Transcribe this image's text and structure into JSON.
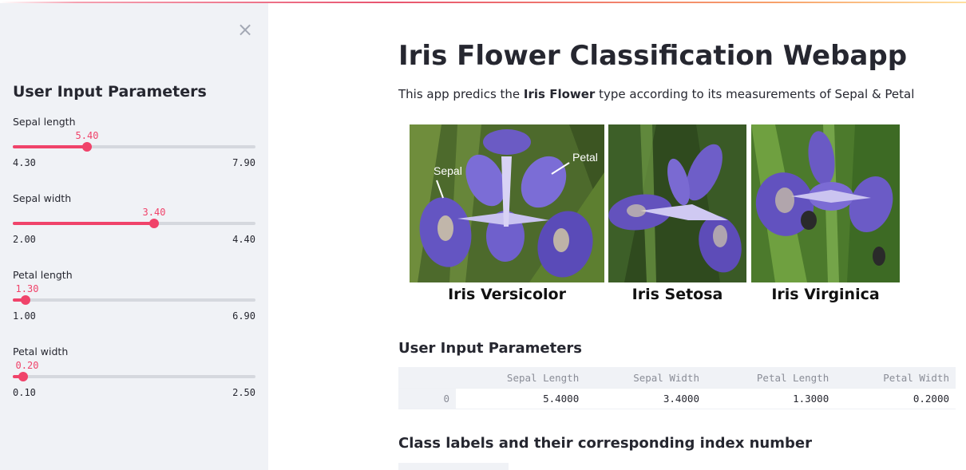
{
  "sidebar": {
    "close_icon": "×",
    "title": "User Input Parameters",
    "accent": "#f0436a",
    "sliders": [
      {
        "label": "Sepal length",
        "value": "5.40",
        "min": "4.30",
        "max": "7.90",
        "fraction": 0.306
      },
      {
        "label": "Sepal width",
        "value": "3.40",
        "min": "2.00",
        "max": "4.40",
        "fraction": 0.583
      },
      {
        "label": "Petal length",
        "value": "1.30",
        "min": "1.00",
        "max": "6.90",
        "fraction": 0.051
      },
      {
        "label": "Petal width",
        "value": "0.20",
        "min": "0.10",
        "max": "2.50",
        "fraction": 0.042
      }
    ]
  },
  "main": {
    "title": "Iris Flower Classification Webapp",
    "description": {
      "before": "This app predics the ",
      "bold": "Iris Flower",
      "after": " type according to its measurements of Sepal & Petal"
    },
    "figure": {
      "captions": [
        "Iris Versicolor",
        "Iris Setosa",
        "Iris Virginica"
      ],
      "annotations": {
        "sepal": "Sepal",
        "petal": "Petal"
      }
    },
    "input_section_title": "User Input Parameters",
    "input_table": {
      "columns": [
        "",
        "Sepal Length",
        "Sepal Width",
        "Petal Length",
        "Petal Width"
      ],
      "rows": [
        {
          "index": "0",
          "values": [
            "5.4000",
            "3.4000",
            "1.3000",
            "0.2000"
          ]
        }
      ]
    },
    "labels_section_title": "Class labels and their corresponding index number"
  }
}
